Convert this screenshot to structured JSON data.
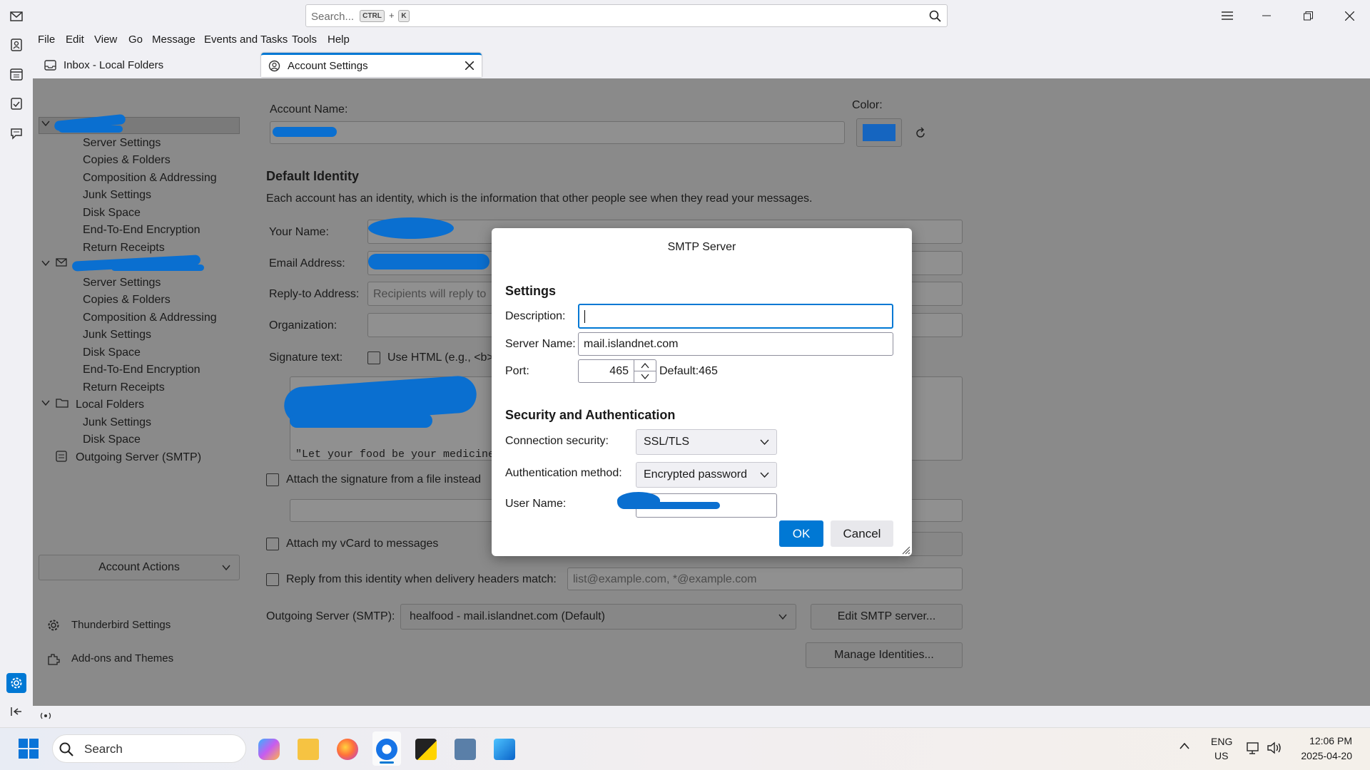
{
  "window": {
    "search_placeholder": "Search...",
    "search_shortcut_ctrl": "CTRL",
    "search_shortcut_plus": "+",
    "search_shortcut_key": "K"
  },
  "menubar": [
    "File",
    "Edit",
    "View",
    "Go",
    "Message",
    "Events and Tasks",
    "Tools",
    "Help"
  ],
  "tabs": [
    {
      "label": "Inbox - Local Folders"
    },
    {
      "label": "Account Settings"
    }
  ],
  "tree": {
    "account1_sub": [
      "Server Settings",
      "Copies & Folders",
      "Composition & Addressing",
      "Junk Settings",
      "Disk Space",
      "End-To-End Encryption",
      "Return Receipts"
    ],
    "account2_sub": [
      "Server Settings",
      "Copies & Folders",
      "Composition & Addressing",
      "Junk Settings",
      "Disk Space",
      "End-To-End Encryption",
      "Return Receipts"
    ],
    "local_folders": "Local Folders",
    "local_sub": [
      "Junk Settings",
      "Disk Space"
    ],
    "outgoing": "Outgoing Server (SMTP)",
    "account_actions": "Account Actions",
    "tb_settings": "Thunderbird Settings",
    "addons": "Add-ons and Themes"
  },
  "page": {
    "account_name_label": "Account Name:",
    "color_label": "Color:",
    "default_identity": "Default Identity",
    "identity_desc": "Each account has an identity, which is the information that other people see when they read your messages.",
    "your_name": "Your Name:",
    "email_address": "Email Address:",
    "reply_to": "Reply-to Address:",
    "reply_to_placeholder": "Recipients will reply to",
    "organization": "Organization:",
    "signature_text": "Signature text:",
    "use_html": "Use HTML (e.g., <b>",
    "sig_quote": "\"Let your food be your medicine",
    "attach_sig_file": "Attach the signature from a file instead",
    "attach_vcard": "Attach my vCard to messages",
    "reply_from": "Reply from this identity when delivery headers match:",
    "reply_from_placeholder": "list@example.com, *@example.com",
    "outgoing_server_label": "Outgoing Server (SMTP):",
    "outgoing_server_value": "healfood - mail.islandnet.com (Default)",
    "edit_smtp": "Edit SMTP server...",
    "manage_identities": "Manage Identities..."
  },
  "dialog": {
    "title": "SMTP Server",
    "settings_heading": "Settings",
    "description_label": "Description:",
    "description_value": "",
    "server_name_label": "Server Name:",
    "server_name_value": "mail.islandnet.com",
    "port_label": "Port:",
    "port_value": "465",
    "port_default": "Default:465",
    "security_heading": "Security and Authentication",
    "connection_security_label": "Connection security:",
    "connection_security_value": "SSL/TLS",
    "auth_method_label": "Authentication method:",
    "auth_method_value": "Encrypted password",
    "username_label": "User Name:",
    "ok": "OK",
    "cancel": "Cancel"
  },
  "taskbar": {
    "search": "Search",
    "lang1": "ENG",
    "lang2": "US",
    "time": "12:06 PM",
    "date": "2025-04-20"
  },
  "colors": {
    "accent": "#0078d4",
    "account_color": "#1565c0",
    "redaction": "#0a6fd0"
  }
}
